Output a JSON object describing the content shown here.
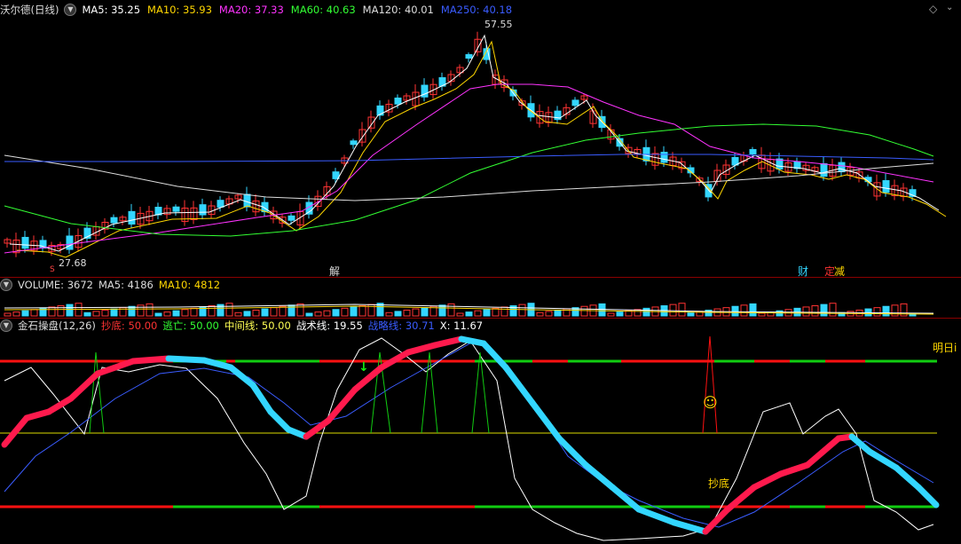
{
  "price_panel": {
    "stock_title": "沃尔德(日线)",
    "indicators": [
      {
        "label": "MA5: ",
        "value": "35.25",
        "color": "#ffffff"
      },
      {
        "label": "MA10: ",
        "value": "35.93",
        "color": "#ffd700"
      },
      {
        "label": "MA20: ",
        "value": "37.33",
        "color": "#ff33ff"
      },
      {
        "label": "MA60: ",
        "value": "40.63",
        "color": "#33ff33"
      },
      {
        "label": "MA120: ",
        "value": "40.01",
        "color": "#dddddd"
      },
      {
        "label": "MA250: ",
        "value": "40.18",
        "color": "#3a5cff"
      }
    ],
    "high_label": "57.55",
    "low_label": "27.68",
    "markers": {
      "jie": "解",
      "cai": "财",
      "ding": "定",
      "jian": "减",
      "s": "S"
    },
    "chart_data": {
      "type": "candlestick",
      "high": 57.55,
      "low": 27.68,
      "ma_last": {
        "MA5": 35.25,
        "MA10": 35.93,
        "MA20": 37.33,
        "MA60": 40.63,
        "MA120": 40.01,
        "MA250": 40.18
      }
    }
  },
  "volume_panel": {
    "title": "VOLUME: ",
    "title_value": "3672",
    "ma5_label": "MA5: ",
    "ma5_value": "4186",
    "ma10_label": "MA10: ",
    "ma10_value": "4812",
    "chart_data": {
      "type": "bar",
      "VOLUME": 3672,
      "MA5": 4186,
      "MA10": 4812
    }
  },
  "indicator_panel": {
    "title": "金石操盘(12,26)",
    "chaodi_label": "抄底: ",
    "chaodi_value": "50.00",
    "taowang_label": "逃亡: ",
    "taowang_value": "50.00",
    "zhongjian_label": "中间线: ",
    "zhongjian_value": "50.00",
    "zhanshu_label": "战术线: ",
    "zhanshu_value": "19.55",
    "zhanlue_label": "战略线: ",
    "zhanlue_value": "30.71",
    "x_label": "X: ",
    "x_value": "11.67",
    "right_note": "明日i",
    "chaodi_annotation": "抄底",
    "smiley": "☺",
    "arrow": "↓",
    "chart_data": {
      "type": "line",
      "抄底": 50.0,
      "逃亡": 50.0,
      "中间线": 50.0,
      "战术线": 19.55,
      "战略线": 30.71,
      "X": 11.67
    }
  },
  "colors": {
    "up": "#ff3333",
    "down": "#33d6ff",
    "ma5": "#ffffff",
    "ma10": "#ffd700",
    "ma20": "#ff33ff",
    "ma60": "#33ff33",
    "ma120": "#dddddd",
    "ma250": "#3a5cff",
    "red_line": "#ff1111",
    "green_line": "#11cc11",
    "yellow_line": "#dddd00"
  },
  "icons": {
    "collapse": "chevron-down-icon",
    "corner": "diamond-icon"
  }
}
